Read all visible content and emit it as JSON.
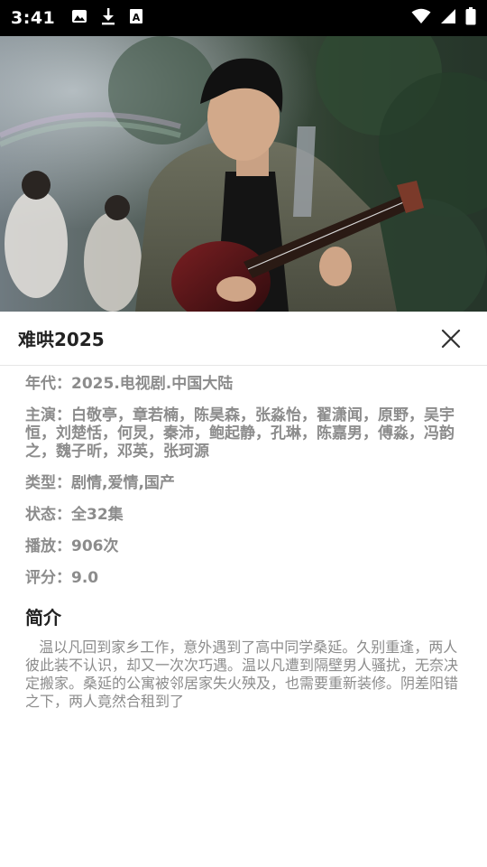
{
  "status_bar": {
    "time": "3:41",
    "left_icons": [
      "image-icon",
      "download-icon",
      "font-icon"
    ],
    "right_icons": [
      "wifi-icon",
      "signal-icon",
      "battery-icon"
    ]
  },
  "hero": {
    "image": "poster-photo-guitarist"
  },
  "sheet": {
    "title": "难哄2025",
    "close_icon": "close-icon"
  },
  "details": {
    "year_label": "年代：",
    "year_value": "2025.电视剧.中国大陆",
    "cast_label": "主演：",
    "cast_value": "白敬亭，章若楠，陈昊森，张淼怡，翟潇闻，原野，吴宇恒，刘楚恬，何炅，秦沛，鲍起静，孔琳，陈嘉男，傅淼，冯韵之，魏子昕，邓英，张珂源",
    "genre_label": "类型：",
    "genre_value": "剧情,爱情,国产",
    "status_label": "状态：",
    "status_value": "全32集",
    "plays_label": "播放：",
    "plays_value": "906次",
    "rating_label": "评分：",
    "rating_value": "9.0"
  },
  "intro": {
    "heading": "简介",
    "text": "温以凡回到家乡工作，意外遇到了高中同学桑延。久别重逢，两人彼此装不认识，却又一次次巧遇。温以凡遭到隔壁男人骚扰，无奈决定搬家。桑延的公寓被邻居家失火殃及，也需要重新装修。阴差阳错之下，两人竟然合租到了"
  }
}
